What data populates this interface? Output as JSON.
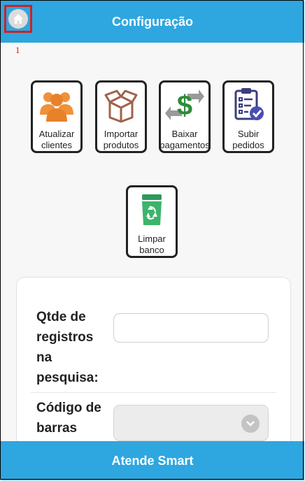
{
  "header": {
    "title": "Configuração"
  },
  "annotation": {
    "marker": "1"
  },
  "tiles": [
    {
      "label": "Atualizar clientes",
      "icon": "users-icon"
    },
    {
      "label": "Importar produtos",
      "icon": "box-icon"
    },
    {
      "label": "Baixar pagamentos",
      "icon": "money-transfer-icon"
    },
    {
      "label": "Subir pedidos",
      "icon": "clipboard-check-icon"
    },
    {
      "label": "Limpar banco",
      "icon": "recycle-bin-icon"
    }
  ],
  "form": {
    "qtde_label": "Qtde de registros na pesquisa:",
    "qtde_value": "",
    "codigo_label": "Código de barras",
    "codigo_value": ""
  },
  "footer": {
    "brand": "Atende Smart"
  },
  "colors": {
    "primary": "#2ea6e0",
    "highlight": "#d32020"
  }
}
